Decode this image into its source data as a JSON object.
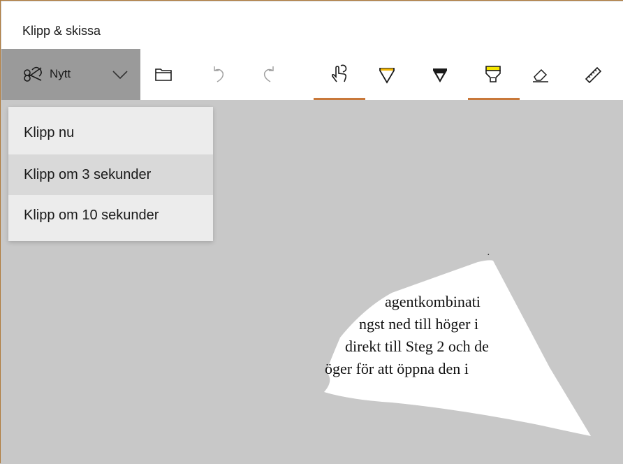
{
  "app": {
    "title": "Klipp & skissa"
  },
  "toolbar": {
    "new_label": "Nytt",
    "icons": [
      "snip-icon",
      "chevron-down-icon",
      "open-file-icon",
      "undo-icon",
      "redo-icon",
      "touch-writing-icon",
      "ballpoint-pen-icon",
      "pencil-icon",
      "highlighter-icon",
      "eraser-icon",
      "ruler-icon"
    ],
    "accent_color": "#c8783a",
    "highlighter_color": "#f5e600",
    "pen_color": "#f0b400"
  },
  "menu": {
    "items": [
      {
        "label": "Klipp nu"
      },
      {
        "label": "Klipp om 3 sekunder"
      },
      {
        "label": "Klipp om 10 sekunder"
      }
    ]
  },
  "snip": {
    "lines": [
      "·",
      "agentkombinati",
      "ngst ned till höger i",
      "direkt till Steg 2 och de",
      "öger för att öppna den i"
    ]
  }
}
